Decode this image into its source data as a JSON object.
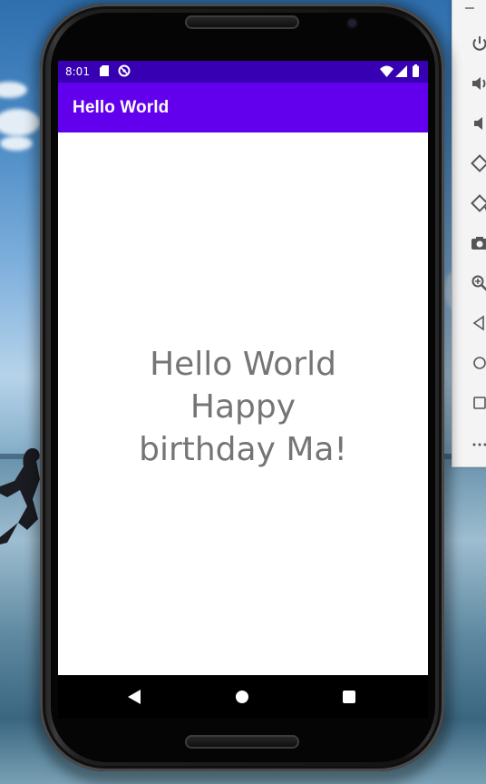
{
  "status_bar": {
    "time": "8:01",
    "icons": [
      "sd-card-icon",
      "data-saver-icon",
      "wifi-icon",
      "cell-signal-icon",
      "battery-icon"
    ],
    "color": "#3700b3"
  },
  "app_bar": {
    "title": "Hello World",
    "color": "#6200ee"
  },
  "content": {
    "lines": [
      "Hello World",
      "Happy",
      "birthday Ma!"
    ],
    "text_color": "#757575",
    "background": "#ffffff"
  },
  "nav_bar": {
    "buttons": [
      "back-icon",
      "home-icon",
      "recents-icon"
    ]
  },
  "emulator_toolbar": {
    "buttons": [
      "power-icon",
      "volume-up-icon",
      "volume-down-icon",
      "rotate-left-icon",
      "rotate-right-icon",
      "camera-icon",
      "zoom-icon",
      "back-icon",
      "home-icon",
      "overview-icon",
      "more-icon"
    ]
  }
}
